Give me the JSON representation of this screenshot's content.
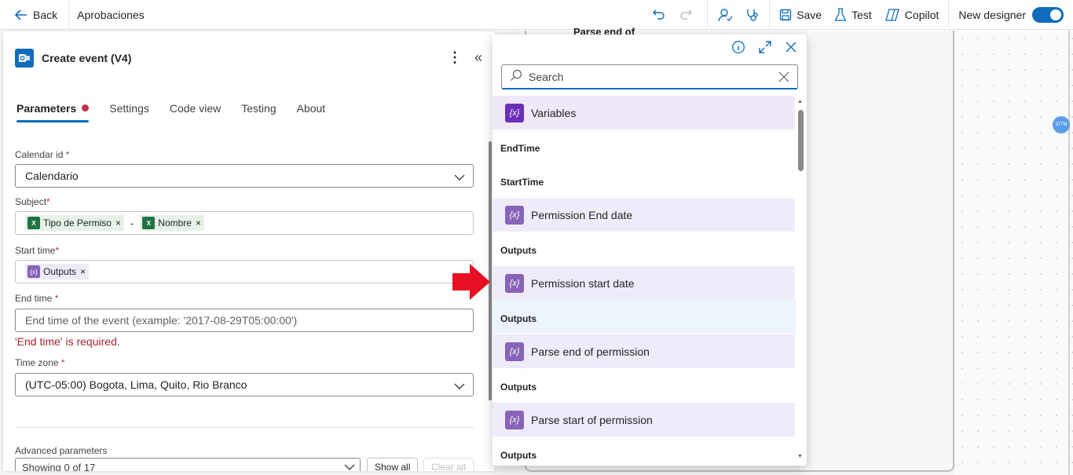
{
  "topbar": {
    "back_label": "Back",
    "flow_name": "Aprobaciones",
    "save_label": "Save",
    "test_label": "Test",
    "copilot_label": "Copilot",
    "new_designer_label": "New designer",
    "new_designer_on": true
  },
  "canvas": {
    "partial_node_label": "Parse end of",
    "zoom_badge": "377M"
  },
  "panel": {
    "title": "Create event (V4)",
    "tabs": [
      {
        "label": "Parameters",
        "active": true,
        "has_error": true
      },
      {
        "label": "Settings"
      },
      {
        "label": "Code view"
      },
      {
        "label": "Testing"
      },
      {
        "label": "About"
      }
    ],
    "calendar_id": {
      "label": "Calendar id",
      "required_mark": "*",
      "value": "Calendario"
    },
    "subject": {
      "label": "Subject",
      "required_mark": "*",
      "token1": "Tipo de Permiso",
      "separator": "-",
      "token2": "Nombre",
      "token_icon_text": "X"
    },
    "start_time": {
      "label": "Start time",
      "required_mark": "*",
      "token": "Outputs"
    },
    "end_time": {
      "label": "End time",
      "required_mark": "*",
      "placeholder": "End time of the event (example: '2017-08-29T05:00:00')",
      "error": "'End time' is required."
    },
    "time_zone": {
      "label": "Time zone",
      "required_mark": "*",
      "value": "(UTC-05:00) Bogota, Lima, Quito, Rio Branco"
    },
    "advanced": {
      "label": "Advanced parameters",
      "select_value": "Showing 0 of 17",
      "show_all": "Show all",
      "clear_all": "Clear all"
    },
    "token_remove": "×"
  },
  "popup": {
    "search_placeholder": "Search",
    "variables_icon": "{x}",
    "var_icon": "{x}",
    "items": [
      {
        "kind": "item",
        "label": "Variables"
      },
      {
        "kind": "header",
        "label": "EndTime"
      },
      {
        "kind": "header",
        "label": "StartTime"
      },
      {
        "kind": "item",
        "label": "Permission End date"
      },
      {
        "kind": "header",
        "label": "Outputs"
      },
      {
        "kind": "item",
        "label": "Permission start date"
      },
      {
        "kind": "header",
        "label": "Outputs"
      },
      {
        "kind": "item",
        "label": "Parse end of permission"
      },
      {
        "kind": "header",
        "label": "Outputs"
      },
      {
        "kind": "item",
        "label": "Parse start of permission"
      },
      {
        "kind": "header",
        "label": "Outputs"
      }
    ]
  },
  "colors": {
    "accent": "#0f6cbd",
    "error": "#a4262c",
    "variable_purple": "#8764b8",
    "excel_green": "#217346",
    "arrow_red": "#e81123"
  }
}
